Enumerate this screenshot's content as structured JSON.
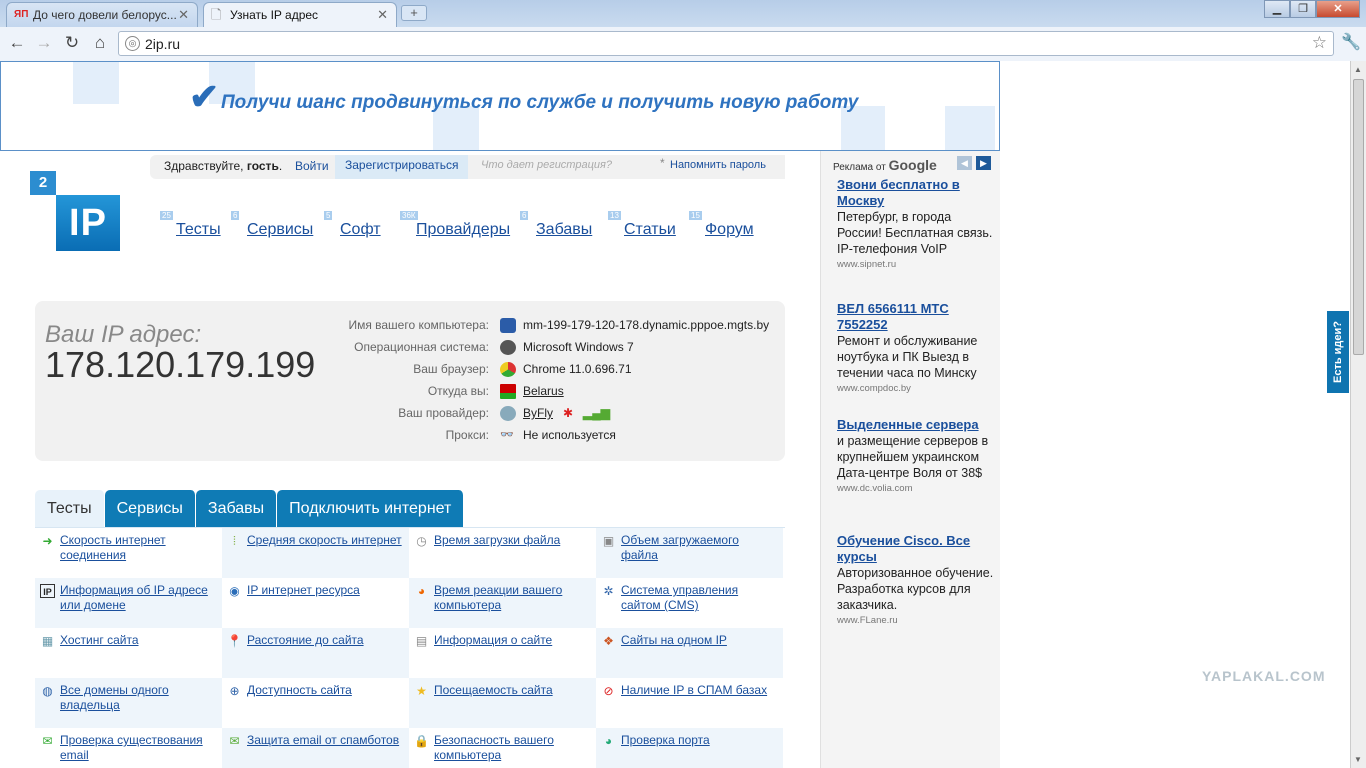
{
  "browser": {
    "tabs": [
      {
        "label": "До чего довели белорус...",
        "favicon": "ЯП"
      },
      {
        "label": "Узнать IP адрес"
      }
    ],
    "address": "2ip.ru"
  },
  "banner": {
    "text": "Получи шанс продвинуться по службе и получить новую работу"
  },
  "login": {
    "greeting": "Здравствуйте,",
    "guest": "гость",
    "login": "Войти",
    "register": "Зарегистрироваться",
    "why": "Что дает регистрация?",
    "star": "*",
    "remind": "Напомнить пароль"
  },
  "logo": {
    "top": "2",
    "main": "IP"
  },
  "nav": [
    {
      "label": "Тесты",
      "badge": "25"
    },
    {
      "label": "Сервисы",
      "badge": "6"
    },
    {
      "label": "Софт",
      "badge": "5"
    },
    {
      "label": "Провайдеры",
      "badge": "36К"
    },
    {
      "label": "Забавы",
      "badge": "6"
    },
    {
      "label": "Статьи",
      "badge": "13"
    },
    {
      "label": "Форум",
      "badge": "15"
    }
  ],
  "ipinfo": {
    "label": "Ваш IP адрес:",
    "ip": "178.120.179.199",
    "rows": [
      {
        "k": "Имя вашего компьютера:",
        "v": "mm-199-179-120-178.dynamic.pppoe.mgts.by"
      },
      {
        "k": "Операционная система:",
        "v": "Microsoft Windows 7"
      },
      {
        "k": "Ваш браузер:",
        "v": "Chrome 11.0.696.71"
      },
      {
        "k": "Откуда вы:",
        "v": "Belarus"
      },
      {
        "k": "Ваш провайдер:",
        "v": "ByFly"
      },
      {
        "k": "Прокси:",
        "v": "Не используется"
      }
    ]
  },
  "tabs": [
    "Тесты",
    "Сервисы",
    "Забавы",
    "Подключить интернет"
  ],
  "tools": [
    [
      "Скорость интернет соединения",
      "Средняя скорость интернет",
      "Время загрузки файла",
      "Объем загружаемого файла"
    ],
    [
      "Информация об IP адресе или домене",
      "IP интернет ресурса",
      "Время реакции вашего компьютера",
      "Система управления сайтом (CMS)"
    ],
    [
      "Хостинг сайта",
      "Расстояние до сайта",
      "Информация о сайте",
      "Сайты на одном IP"
    ],
    [
      "Все домены одного владельца",
      "Доступность сайта",
      "Посещаемость сайта",
      "Наличие IP в СПАМ базах"
    ],
    [
      "Проверка существования email",
      "Защита email от спамботов",
      "Безопасность вашего компьютера",
      "Проверка порта"
    ]
  ],
  "ads": {
    "header": "Реклама от",
    "brand": "Google",
    "items": [
      {
        "title": "Звони бесплатно в Москву",
        "desc": "Петербург, в города России! Бесплатная связь. IP-телефония VoIP",
        "url": "www.sipnet.ru"
      },
      {
        "title": "ВЕЛ 6566111 МТС 7552252",
        "desc": "Ремонт и обслуживание ноутбука и ПК Выезд в течении часа по Минску",
        "url": "www.compdoc.by"
      },
      {
        "title": "Выделенные сервера",
        "desc": "и размещение серверов в крупнейшем украинском Дата-центре Воля от 38$",
        "url": "www.dc.volia.com"
      },
      {
        "title": "Обучение Cisco. Все курсы",
        "desc": "Авторизованное обучение. Разработка курсов для заказчика.",
        "url": "www.FLane.ru"
      }
    ]
  },
  "sidetab": "Есть идеи?",
  "watermark": "YAPLAKAL.COM"
}
